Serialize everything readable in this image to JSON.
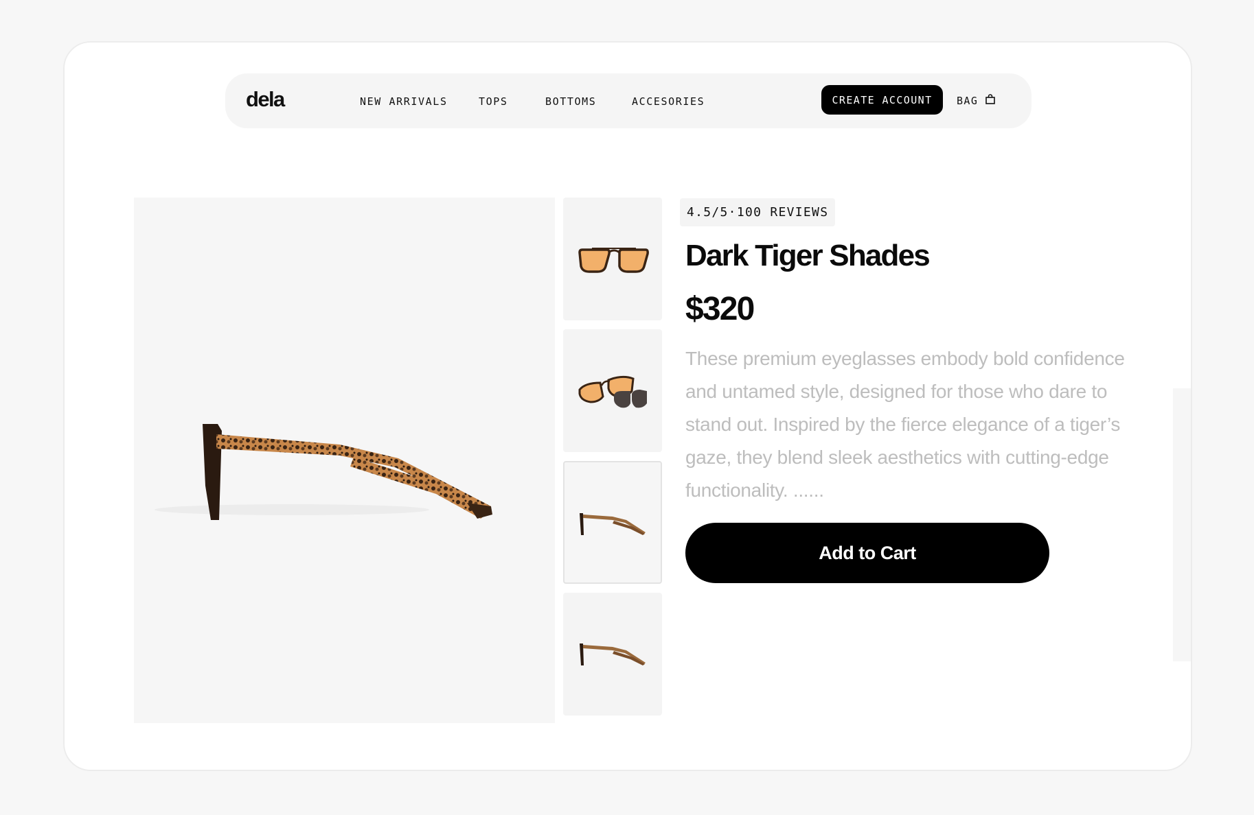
{
  "brand": {
    "logo_text": "dela"
  },
  "nav": {
    "links": [
      {
        "label": "NEW ARRIVALS"
      },
      {
        "label": "TOPS"
      },
      {
        "label": "BOTTOMS"
      },
      {
        "label": "ACCESORIES"
      }
    ],
    "create_account_label": "CREATE ACCOUNT",
    "bag_label": "BAG",
    "bag_icon": "shopping-bag-icon"
  },
  "product": {
    "rating_text": "4.5/5·100 REVIEWS",
    "title": "Dark Tiger Shades",
    "price": "$320",
    "description": "These premium eyeglasses embody bold confidence and untamed style, designed for those who dare to stand out. Inspired by the fierce elegance of a tiger’s gaze, they blend sleek aesthetics with cutting-edge functionality. ......",
    "add_to_cart_label": "Add to Cart",
    "main_image": "glasses-side-view-image",
    "thumbnails": [
      {
        "image": "glasses-front-view-thumbnail",
        "selected": false
      },
      {
        "image": "glasses-with-clip-on-thumbnail",
        "selected": false
      },
      {
        "image": "glasses-side-view-thumbnail",
        "selected": true
      },
      {
        "image": "glasses-side-angle-thumbnail",
        "selected": false
      }
    ]
  },
  "colors": {
    "accent": "#000000",
    "page_bg": "#f7f7f7",
    "card_bg": "#ffffff",
    "muted_text": "#bdbdbd",
    "tortoise_dark": "#2a1a10",
    "tortoise_light": "#c8874a",
    "lens_orange": "#f2b06a"
  }
}
